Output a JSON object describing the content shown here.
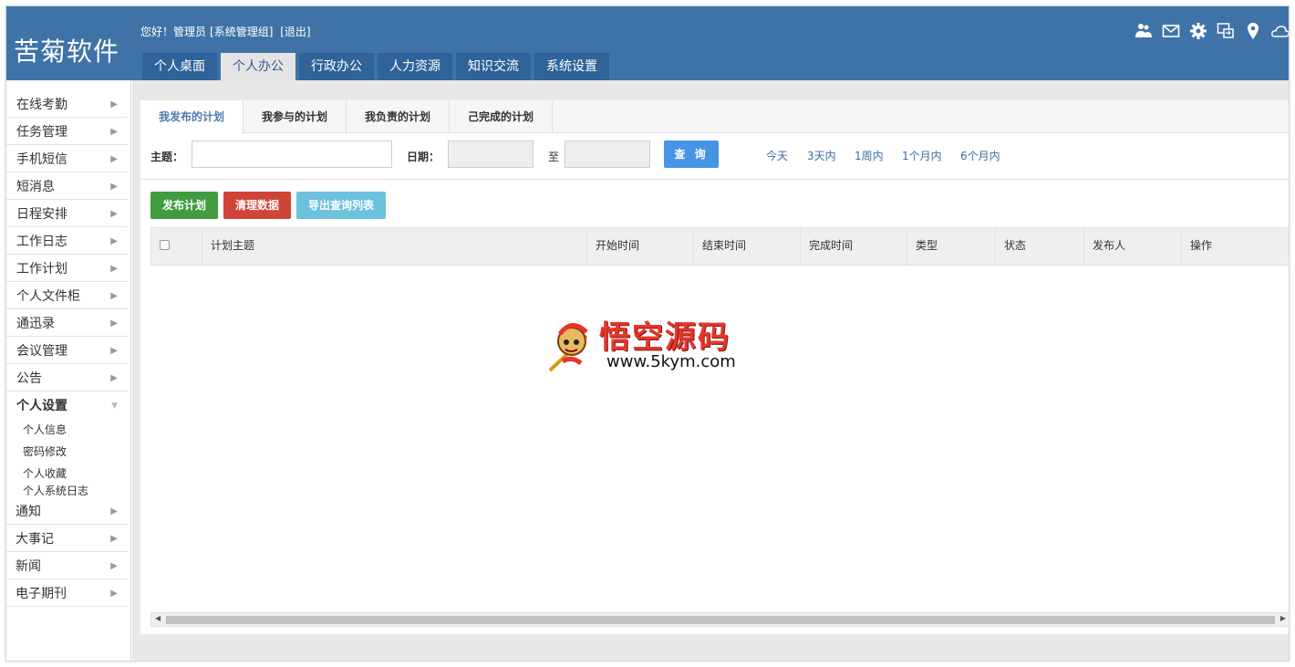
{
  "app": {
    "logo": "苦菊软件",
    "greeting": "您好！管理员",
    "group": "[系统管理组]",
    "logout": "[退出]"
  },
  "nav_tabs": [
    {
      "label": "个人桌面",
      "active": false
    },
    {
      "label": "个人办公",
      "active": true
    },
    {
      "label": "行政办公",
      "active": false
    },
    {
      "label": "人力资源",
      "active": false
    },
    {
      "label": "知识交流",
      "active": false
    },
    {
      "label": "系统设置",
      "active": false
    }
  ],
  "header_icons": [
    "users-icon",
    "mail-icon",
    "gear-icon",
    "window-switch-icon",
    "location-pin-icon",
    "cloud-icon"
  ],
  "sidebar": {
    "items": [
      {
        "label": "在线考勤"
      },
      {
        "label": "任务管理"
      },
      {
        "label": "手机短信"
      },
      {
        "label": "短消息"
      },
      {
        "label": "日程安排"
      },
      {
        "label": "工作日志"
      },
      {
        "label": "工作计划"
      },
      {
        "label": "个人文件柜"
      },
      {
        "label": "通迅录"
      },
      {
        "label": "会议管理"
      },
      {
        "label": "公告"
      },
      {
        "label": "个人设置"
      },
      {
        "label": "通知"
      },
      {
        "label": "大事记"
      },
      {
        "label": "新闻"
      },
      {
        "label": "电子期刊"
      }
    ],
    "open_index": 11,
    "sub_items": [
      {
        "label": "个人信息"
      },
      {
        "label": "密码修改"
      },
      {
        "label": "个人收藏"
      },
      {
        "label": "个人系统日志"
      }
    ]
  },
  "sub_tabs": [
    {
      "label": "我发布的计划",
      "active": true
    },
    {
      "label": "我参与的计划",
      "active": false
    },
    {
      "label": "我负责的计划",
      "active": false
    },
    {
      "label": "己完成的计划",
      "active": false
    }
  ],
  "filter": {
    "subject_label": "主题：",
    "subject_value": "",
    "date_label": "日期：",
    "date_from": "",
    "to_label": "至",
    "date_to": "",
    "query_button": "查 询",
    "quick_ranges": [
      "今天",
      "3天内",
      "1周内",
      "1个月内",
      "6个月内"
    ]
  },
  "actions": {
    "publish": "发布计划",
    "clear": "清理数据",
    "export": "导出查询列表"
  },
  "table": {
    "columns": [
      "计划主题",
      "开始时间",
      "结束时间",
      "完成时间",
      "类型",
      "状态",
      "发布人",
      "操作"
    ],
    "rows": []
  },
  "watermark": {
    "title": "悟空源码",
    "url": "www.5kym.com"
  },
  "colors": {
    "header": "#3f73a8",
    "tab_dark": "#2f6399",
    "query_button": "#4694e6",
    "publish_button": "#3f9d3f",
    "clear_button": "#cf4436",
    "export_button": "#6cc1dd"
  }
}
